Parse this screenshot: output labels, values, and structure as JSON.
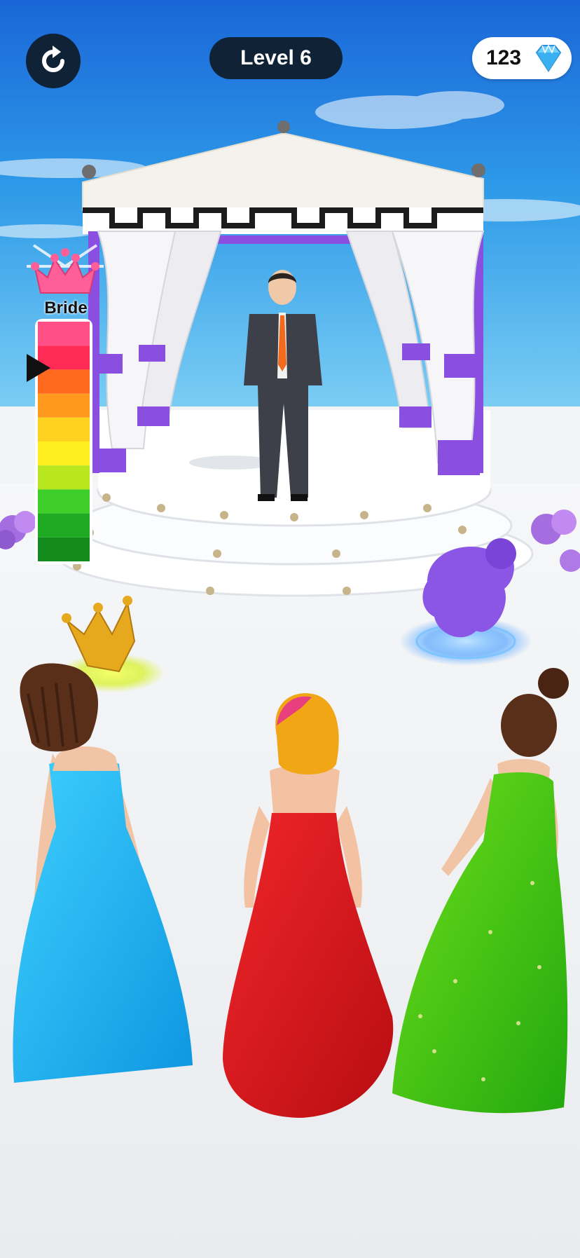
{
  "hud": {
    "restart_icon": "restart-icon",
    "level_label": "Level 6",
    "gems": {
      "count": "123",
      "icon": "diamond-icon"
    }
  },
  "bride_meter": {
    "label": "Bride",
    "crown_icon": "crown-icon",
    "levels": [
      "#ff4f86",
      "#ff2a55",
      "#ff6a1f",
      "#ff9a1f",
      "#ffd21f",
      "#ffee1f",
      "#b8e61f",
      "#3ecf2a",
      "#1eaa23",
      "#138a1c"
    ],
    "pointer_level": 0.8
  },
  "scene": {
    "groom": "groom",
    "pickups": [
      "gold-crown-pickup",
      "purple-hair-pickup"
    ],
    "brides": [
      {
        "name": "blue-gown-bride",
        "dress_color": "#1fb8f0"
      },
      {
        "name": "red-gown-bride",
        "dress_color": "#e0161c"
      },
      {
        "name": "green-gown-bride",
        "dress_color": "#3ec313"
      }
    ]
  }
}
